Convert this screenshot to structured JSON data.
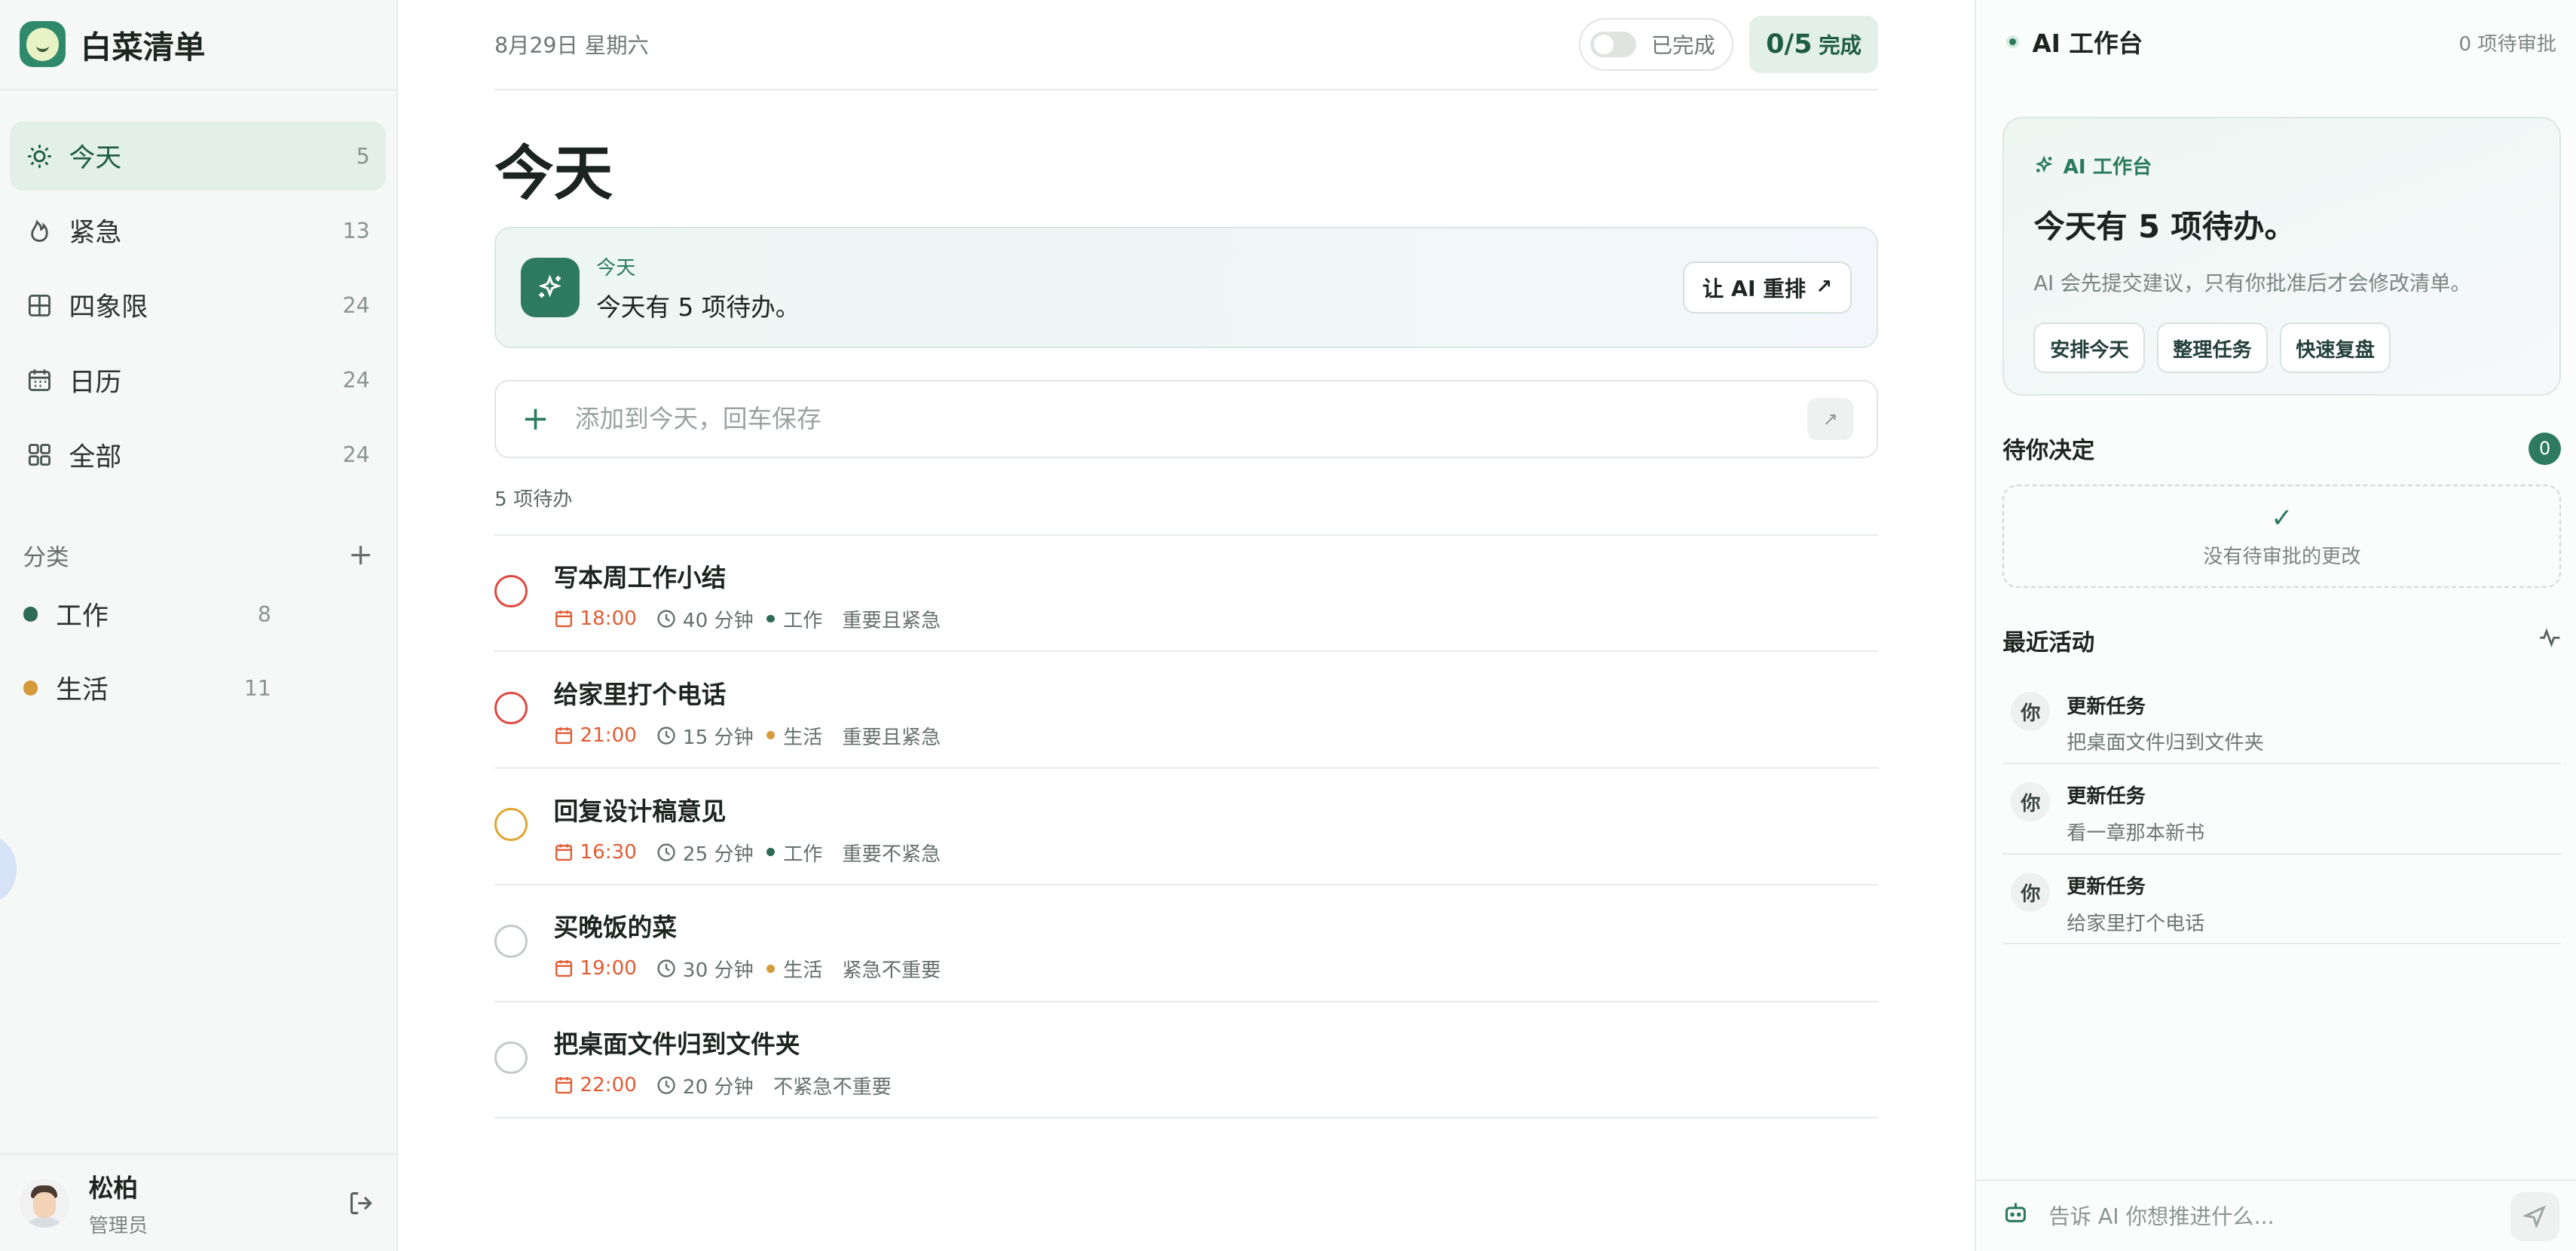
{
  "app": {
    "name": "白菜清单"
  },
  "sidebar": {
    "nav": [
      {
        "label": "今天",
        "count": "5",
        "icon": "sun-icon",
        "active": true
      },
      {
        "label": "紧急",
        "count": "13",
        "icon": "flame-icon"
      },
      {
        "label": "四象限",
        "count": "24",
        "icon": "quadrant-icon"
      },
      {
        "label": "日历",
        "count": "24",
        "icon": "calendar-icon"
      },
      {
        "label": "全部",
        "count": "24",
        "icon": "grid-icon"
      }
    ],
    "categories_title": "分类",
    "add_icon": "plus-icon",
    "categories": [
      {
        "label": "工作",
        "count": "8",
        "color": "#2e6b55"
      },
      {
        "label": "生活",
        "count": "11",
        "color": "#d69a3b"
      }
    ],
    "user": {
      "name": "松柏",
      "role": "管理员"
    }
  },
  "main": {
    "date": "8月29日 星期六",
    "toggle_label": "已完成",
    "progress_value": "0/5",
    "progress_label": "完成",
    "title": "今天",
    "banner": {
      "kicker": "今天",
      "text": "今天有 5 项待办。",
      "button": "让 AI 重排",
      "button_icon": "arrow-up-right-icon"
    },
    "add": {
      "placeholder": "添加到今天，回车保存"
    },
    "count_label": "5 项待办",
    "tasks": [
      {
        "title": "写本周工作小结",
        "time": "18:00",
        "duration": "40 分钟",
        "category": "工作",
        "category_color": "#2e6b55",
        "quadrant": "重要且紧急",
        "check_color": "#e0493f"
      },
      {
        "title": "给家里打个电话",
        "time": "21:00",
        "duration": "15 分钟",
        "category": "生活",
        "category_color": "#d69a3b",
        "quadrant": "重要且紧急",
        "check_color": "#e0493f"
      },
      {
        "title": "回复设计稿意见",
        "time": "16:30",
        "duration": "25 分钟",
        "category": "工作",
        "category_color": "#2e6b55",
        "quadrant": "重要不紧急",
        "check_color": "#e0a533"
      },
      {
        "title": "买晚饭的菜",
        "time": "19:00",
        "duration": "30 分钟",
        "category": "生活",
        "category_color": "#d69a3b",
        "quadrant": "紧急不重要",
        "check_color": "#c4cbc7"
      },
      {
        "title": "把桌面文件归到文件夹",
        "time": "22:00",
        "duration": "20 分钟",
        "category": "",
        "category_color": "",
        "quadrant": "不紧急不重要",
        "check_color": "#c4cbc7"
      }
    ]
  },
  "panel": {
    "title": "AI 工作台",
    "pending": "0 项待审批",
    "card": {
      "kicker": "AI 工作台",
      "title": "今天有 5 项待办。",
      "subtitle": "AI 会先提交建议，只有你批准后才会修改清单。",
      "chips": [
        "安排今天",
        "整理任务",
        "快速复盘"
      ]
    },
    "decide": {
      "title": "待你决定",
      "count": "0",
      "empty": "没有待审批的更改"
    },
    "recent": {
      "title": "最近活动",
      "items": [
        {
          "who": "你",
          "title": "更新任务",
          "desc": "把桌面文件归到文件夹"
        },
        {
          "who": "你",
          "title": "更新任务",
          "desc": "看一章那本新书"
        },
        {
          "who": "你",
          "title": "更新任务",
          "desc": "给家里打个电话"
        }
      ]
    },
    "composer": {
      "placeholder": "告诉 AI 你想推进什么..."
    }
  }
}
